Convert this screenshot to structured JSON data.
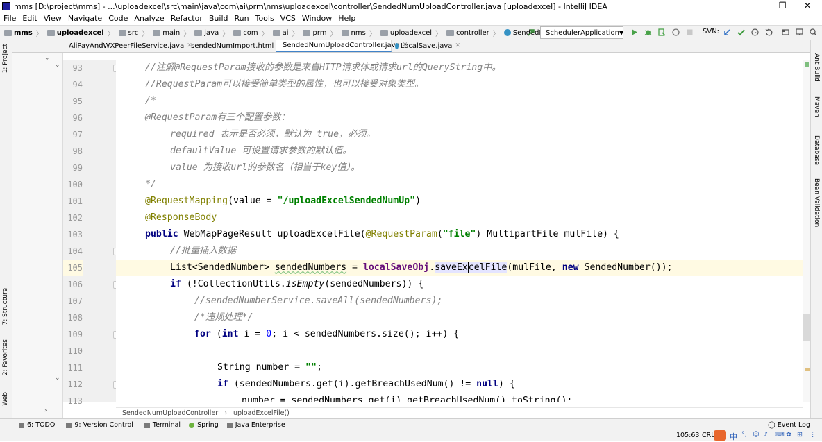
{
  "window": {
    "title": "mms [D:\\project\\mms] - ...\\uploadexcel\\src\\main\\java\\com\\ai\\prm\\nms\\uploadexcel\\controller\\SendedNumUploadController.java [uploadexcel] - IntelliJ IDEA",
    "minimize": "–",
    "maximize": "❐",
    "close": "✕"
  },
  "menu": [
    "File",
    "Edit",
    "View",
    "Navigate",
    "Code",
    "Analyze",
    "Refactor",
    "Build",
    "Run",
    "Tools",
    "VCS",
    "Window",
    "Help"
  ],
  "breadcrumbs": [
    "mms",
    "uploadexcel",
    "src",
    "main",
    "java",
    "com",
    "ai",
    "prm",
    "nms",
    "uploadexcel",
    "controller",
    "SendedNumUploadController"
  ],
  "run_config": "SchedulerApplication",
  "svn_label": "SVN:",
  "tabs": [
    {
      "label": "AliPayAndWXPeerFileService.java",
      "icon": "class-icon",
      "active": false
    },
    {
      "label": "sendedNumImport.html",
      "icon": "html-icon",
      "active": false
    },
    {
      "label": "SendedNumUploadController.java",
      "icon": "class-icon",
      "active": true
    },
    {
      "label": "LocalSave.java",
      "icon": "class-icon",
      "active": false
    }
  ],
  "left_tool_windows": [
    "1: Project",
    "7: Structure",
    "2: Favorites",
    "Web"
  ],
  "right_tool_windows": [
    "Ant Build",
    "Maven",
    "Database",
    "Bean Validation"
  ],
  "line_numbers": [
    "93",
    "94",
    "95",
    "96",
    "97",
    "98",
    "99",
    "100",
    "101",
    "102",
    "103",
    "104",
    "105",
    "106",
    "107",
    "108",
    "109",
    "110",
    "111",
    "112",
    "113"
  ],
  "code": {
    "l93": "//注解@RequestParam接收的参数是来自HTTP请求体或请求url的QueryString中。",
    "l94": "//RequestParam可以接受简单类型的属性，也可以接受对象类型。",
    "l95": "/*",
    "l96": "@RequestParam有三个配置参数：",
    "l97": "required 表示是否必须，默认为 true，必须。",
    "l98": "defaultValue 可设置请求参数的默认值。",
    "l99": "value 为接收url的参数名（相当于key值）。",
    "l100": "*/",
    "l101_ann": "@RequestMapping",
    "l101_a": "(value = ",
    "l101_str": "\"/uploadExcelSendedNumUp\"",
    "l101_b": ")",
    "l102_ann": "@ResponseBody",
    "l103_kw": "public",
    "l103_a": " WebMapPageResult uploadExcelFile(",
    "l103_ann": "@RequestParam",
    "l103_b": "(",
    "l103_str": "\"file\"",
    "l103_c": ") MultipartFile mulFile) {",
    "l104": "//批量插入数据",
    "l105_a": "List<SendedNumber> ",
    "l105_var": "sendedNumbers",
    "l105_b": " = ",
    "l105_fld": "localSaveObj",
    "l105_c": ".",
    "l105_m1": "saveEx",
    "l105_m2": "celFile",
    "l105_d": "(mulFile, ",
    "l105_kw": "new",
    "l105_e": " SendedNumber());",
    "l106_kw": "if",
    "l106_a": " (!CollectionUtils.",
    "l106_it": "isEmpty",
    "l106_b": "(sendedNumbers)) {",
    "l107": "//sendedNumberService.saveAll(sendedNumbers);",
    "l108": "/*违规处理*/",
    "l109_kw": "for",
    "l109_a": " (",
    "l109_kw2": "int",
    "l109_b": " i = ",
    "l109_num": "0",
    "l109_c": "; i < sendedNumbers.size(); i++) {",
    "l111_a": "String number = ",
    "l111_str": "\"\"",
    "l111_b": ";",
    "l112_kw": "if",
    "l112_a": " (sendedNumbers.get(i).getBreachUsedNum() != ",
    "l112_kw2": "null",
    "l112_b": ") {",
    "l113": "number = sendedNumbers.get(i).getBreachUsedNum().toString();"
  },
  "editor_breadcrumb": [
    "SendedNumUploadController",
    "uploadExcelFile()"
  ],
  "bottom_tools": [
    {
      "label": "6: TODO",
      "icon": "todo-icon"
    },
    {
      "label": "9: Version Control",
      "icon": "vcs-icon"
    },
    {
      "label": "Terminal",
      "icon": "terminal-icon"
    },
    {
      "label": "Spring",
      "icon": "spring-icon"
    },
    {
      "label": "Java Enterprise",
      "icon": "javaee-icon"
    }
  ],
  "event_log": "Event Log",
  "status": {
    "position": "105:63",
    "line_sep": "CRL",
    "ime": "中"
  }
}
